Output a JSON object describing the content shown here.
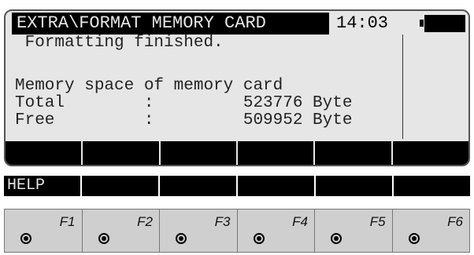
{
  "header": {
    "title": "EXTRA\\FORMAT MEMORY CARD",
    "time": "14:03"
  },
  "content": {
    "status": " Formatting finished.",
    "heading": "Memory space of memory card",
    "total_row": "Total        :         523776 Byte",
    "free_row": "Free         :         509952 Byte"
  },
  "softkeys": [
    "",
    "",
    "",
    "",
    "",
    ""
  ],
  "help_row": {
    "help_label": "HELP"
  },
  "function_keys": [
    "F1",
    "F2",
    "F3",
    "F4",
    "F5",
    "F6"
  ]
}
